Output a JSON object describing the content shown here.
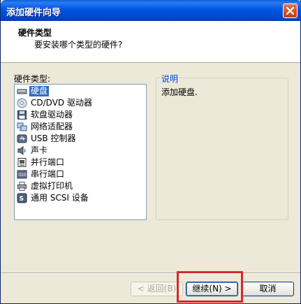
{
  "window": {
    "title": "添加硬件向导"
  },
  "header": {
    "title": "硬件类型",
    "subtitle": "要安装哪个类型的硬件?"
  },
  "hardware_list": {
    "label": "硬件类型:",
    "selected_index": 0,
    "items": [
      {
        "label": "硬盘",
        "icon": "hard-disk-icon"
      },
      {
        "label": "CD/DVD 驱动器",
        "icon": "cd-dvd-icon"
      },
      {
        "label": "软盘驱动器",
        "icon": "floppy-drive-icon"
      },
      {
        "label": "网络适配器",
        "icon": "network-adapter-icon"
      },
      {
        "label": "USB 控制器",
        "icon": "usb-icon"
      },
      {
        "label": "声卡",
        "icon": "sound-card-icon"
      },
      {
        "label": "并行端口",
        "icon": "parallel-port-icon"
      },
      {
        "label": "串行端口",
        "icon": "serial-port-icon"
      },
      {
        "label": "虚拟打印机",
        "icon": "printer-icon"
      },
      {
        "label": "通用 SCSI 设备",
        "icon": "scsi-device-icon"
      }
    ]
  },
  "description": {
    "title": "说明",
    "text": "添加硬盘."
  },
  "buttons": {
    "back": "< 返回(B)",
    "next": "继续(N) >",
    "cancel": "取消"
  },
  "colors": {
    "titlebar": "#0055e5",
    "selection": "#316ac5",
    "group_title": "#0046d5",
    "annotation_box": "#d9262a"
  }
}
